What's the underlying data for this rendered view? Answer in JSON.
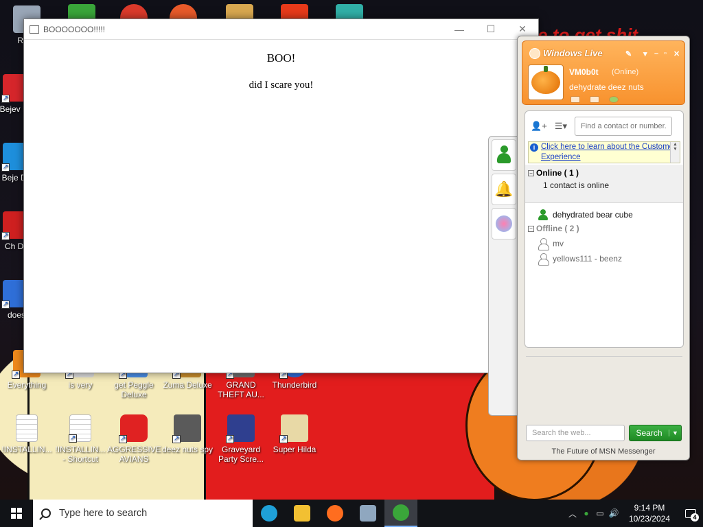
{
  "desktop": {
    "wallpaper_text": "me to get shit",
    "icons_left": [
      {
        "label": "Recy",
        "color": "#9aa7b8"
      },
      {
        "label": "Bejev De",
        "color": "#d6262b"
      },
      {
        "label": "Beje De",
        "color": "#1e8fdc"
      },
      {
        "label": "Ch De",
        "color": "#cf2020"
      },
      {
        "label": "does",
        "color": "#2f6fd8"
      }
    ],
    "icons_row1": [
      {
        "label": "Everything",
        "color": "#f08a1c"
      },
      {
        "label": "is very",
        "color": "#ddd"
      },
      {
        "label": "get Peggle Deluxe",
        "color": "#4a8ee8"
      },
      {
        "label": "Zuma Deluxe",
        "color": "#c98d2c"
      },
      {
        "label": "GRAND THEFT AU...",
        "color": "#6d6d6d"
      },
      {
        "label": "Thunderbird",
        "color": "#2c6ad8"
      }
    ],
    "icons_row2": [
      {
        "label": "!INSTALLIN...",
        "color": "doc"
      },
      {
        "label": "!INSTALLIN... - Shortcut",
        "color": "doc"
      },
      {
        "label": "AGGRESSIVE AVIANS",
        "color": "#e02222"
      },
      {
        "label": "deez nuts spy",
        "color": "#5a5a5a"
      },
      {
        "label": "Graveyard Party Scre...",
        "color": "#2f3f8f"
      },
      {
        "label": "Super Hilda",
        "color": "#e8d9a6"
      }
    ]
  },
  "window": {
    "title": "BOOOOOOO!!!!!",
    "minimize": "—",
    "maximize": "☐",
    "close": "✕",
    "heading": "BOO!",
    "body": "did I scare you!"
  },
  "msn": {
    "brand": "Windows Live",
    "user_name": "VM0b0t",
    "user_status": "(Online)",
    "personal_message": "dehydrate deez nuts",
    "find_placeholder": "Find a contact or number...",
    "info_link": "Click here to learn about the Customer Experience",
    "online_group": "Online ( 1 )",
    "online_summary": "1 contact is online",
    "offline_group": "Offline ( 2 )",
    "contacts_online": [
      "dehydrated bear cube"
    ],
    "contacts_offline": [
      "mv",
      "yellows111 - beenz"
    ],
    "web_search_placeholder": "Search the web...",
    "search_button": "Search",
    "footer": "The Future of MSN Messenger"
  },
  "taskbar": {
    "search_placeholder": "Type here to search",
    "apps": [
      {
        "name": "edge",
        "color": "#1fa0d8"
      },
      {
        "name": "file-explorer",
        "color": "#f2c032"
      },
      {
        "name": "firefox",
        "color": "#ff6d1f"
      },
      {
        "name": "app-window",
        "color": "#8fa7bf"
      },
      {
        "name": "msn-messenger",
        "color": "#3aa63a"
      }
    ],
    "time": "9:14 PM",
    "date": "10/23/2024",
    "notification_count": "4"
  }
}
